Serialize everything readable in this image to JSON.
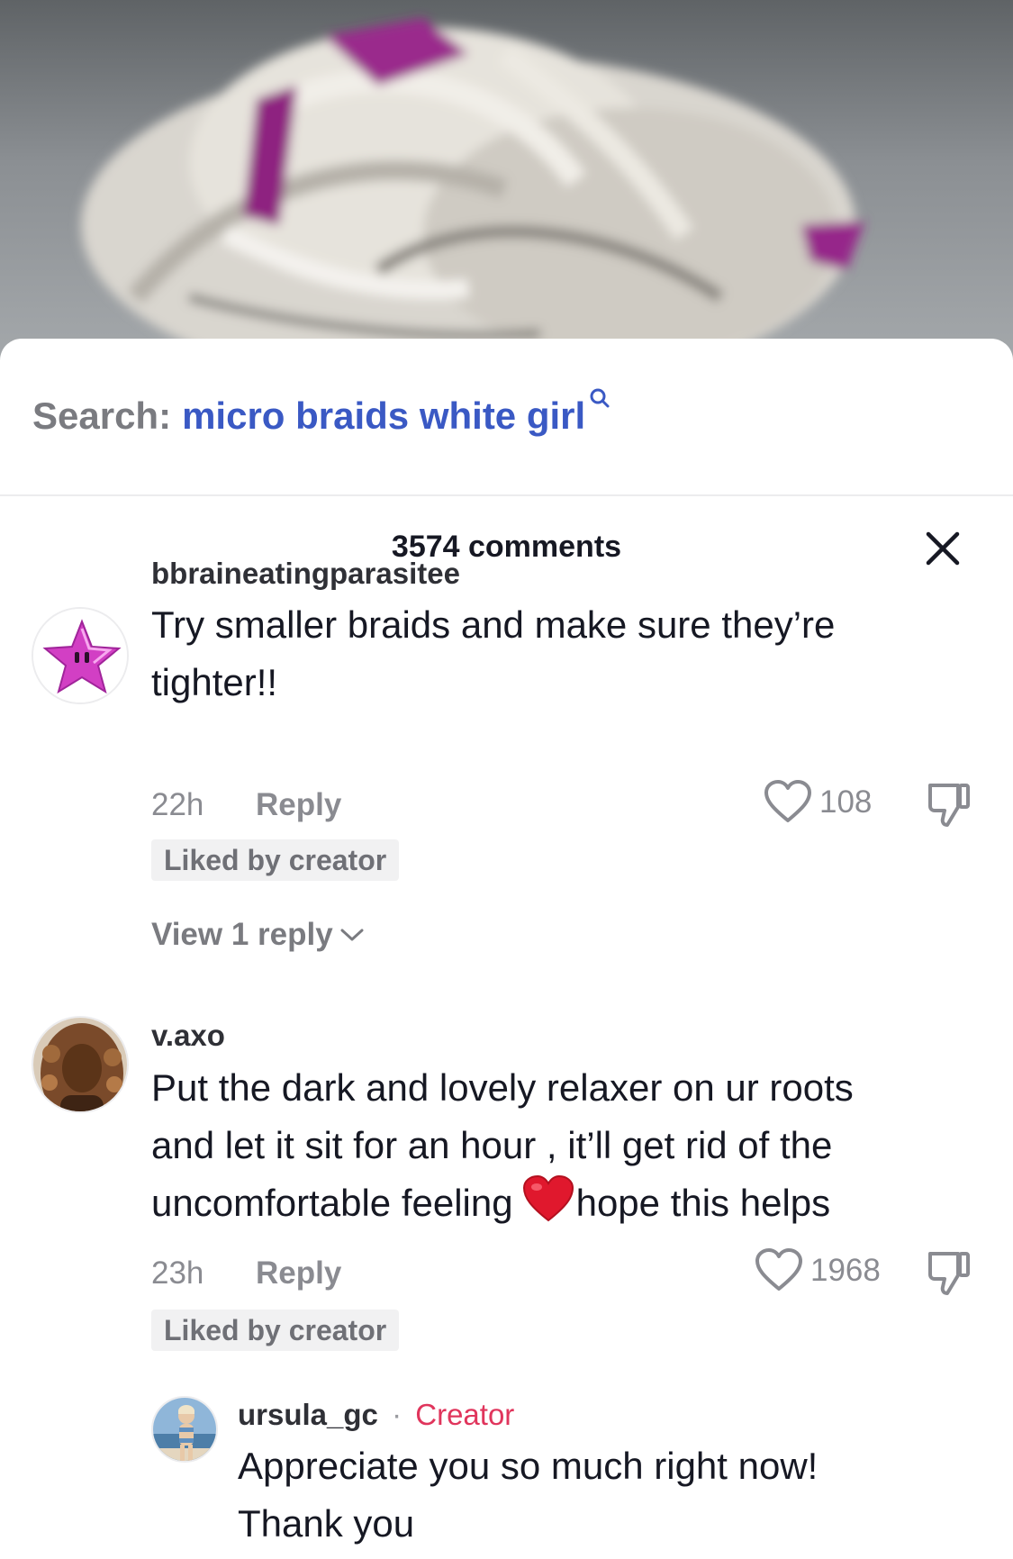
{
  "search": {
    "prefix": "Search:",
    "query": "micro braids white girl"
  },
  "comments_header": {
    "title": "3574 comments"
  },
  "comments": [
    {
      "username": "bbraineatingparasitee",
      "text_lines": [
        "Try smaller braids and make sure they’re",
        "tighter!!"
      ],
      "time": "22h",
      "reply_label": "Reply",
      "likes": "108",
      "liked_badge": "Liked by creator",
      "view_replies": "View 1 reply",
      "avatar_icon": "pink-star-icon"
    },
    {
      "username": "v.axo",
      "text_lines": [
        "Put the dark and lovely relaxer on ur roots",
        "and let it sit for an hour , it’ll get rid of the",
        "uncomfortable feeling",
        "hope this helps"
      ],
      "time": "23h",
      "reply_label": "Reply",
      "likes": "1968",
      "liked_badge": "Liked by creator",
      "avatar_icon": "user-photo"
    }
  ],
  "reply": {
    "username": "ursula_gc",
    "dot": "·",
    "creator_label": "Creator",
    "text_lines": [
      "Appreciate you so much right now!",
      "Thank you"
    ],
    "avatar_icon": "user-photo"
  },
  "colors": {
    "link_blue": "#3a59c4",
    "creator_red": "#e0355c",
    "heart_emoji": "#e0182d"
  }
}
